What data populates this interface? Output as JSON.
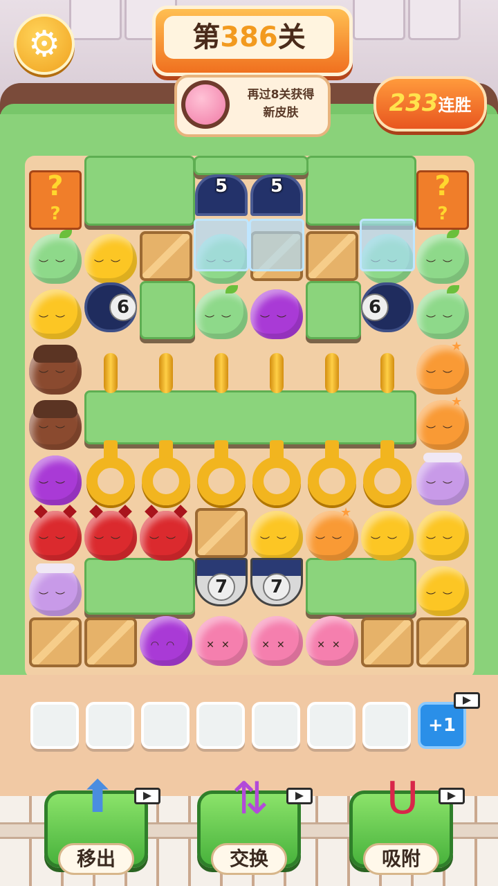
{
  "header": {
    "level_prefix": "第",
    "level_number": "386",
    "level_suffix": "关",
    "reward_line1": "再过8关获得",
    "reward_line2": "新皮肤",
    "streak_number": "233",
    "streak_label": "连胜"
  },
  "board": {
    "pipe_counts": {
      "top_left": "5",
      "top_right": "5",
      "side_left": "6",
      "side_right": "6",
      "bottom_left": "7",
      "bottom_right": "7"
    },
    "mystery_symbol": "?"
  },
  "tray": {
    "empty_slots": 7,
    "add_slot_label": "+1"
  },
  "boosters": [
    {
      "label": "移出",
      "icon": "cards-up-icon"
    },
    {
      "label": "交换",
      "icon": "swap-arrows-icon"
    },
    {
      "label": "吸附",
      "icon": "magnet-icon"
    }
  ],
  "colors": {
    "accent_orange": "#f0701f",
    "button_green": "#48b23c",
    "add_slot_blue": "#2a8fe8",
    "lawn_green": "#8ad27a"
  }
}
